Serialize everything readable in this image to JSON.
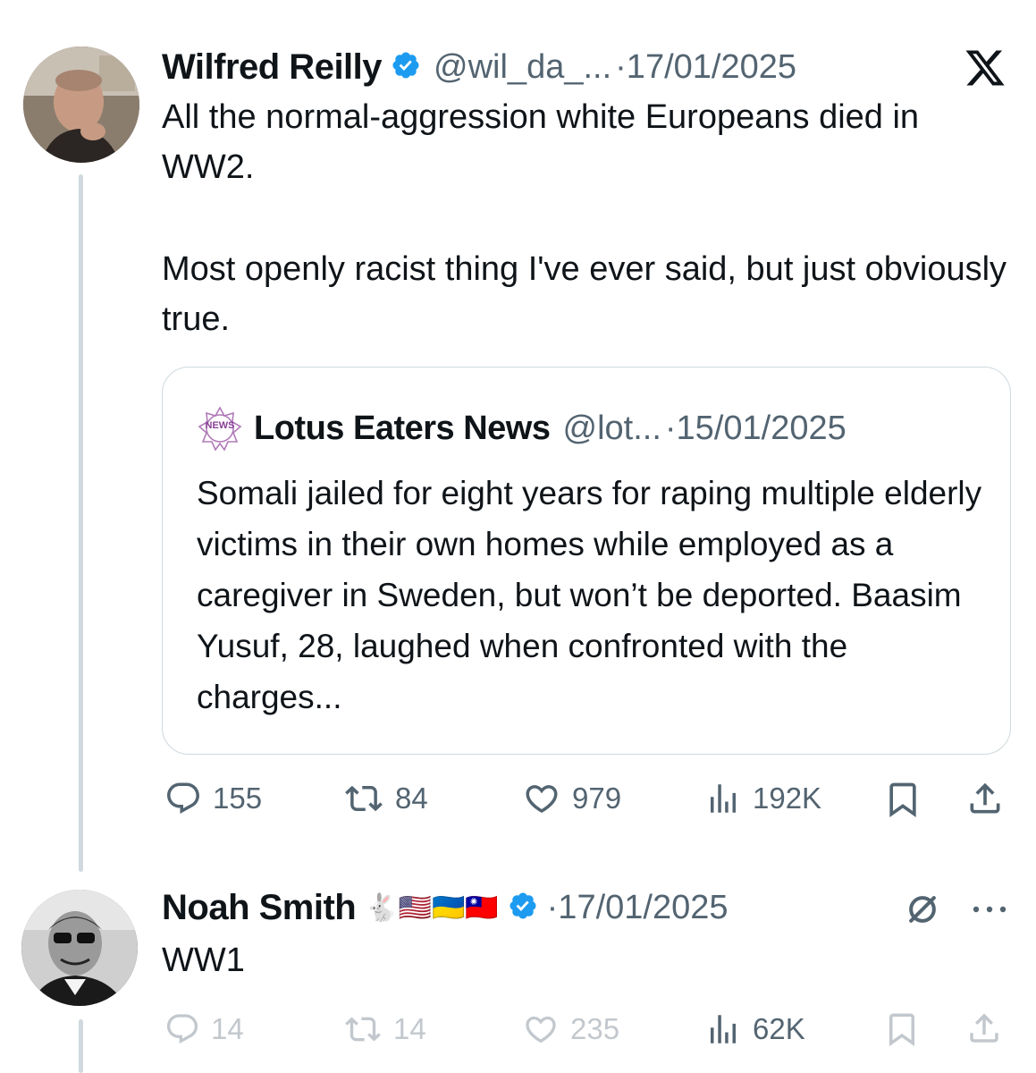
{
  "tweet": {
    "author_name": "Wilfred Reilly",
    "handle": "@wil_da_...",
    "date": "·17/01/2025",
    "body_line1": "All the normal-aggression white Europeans died in WW2.",
    "body_line2": "Most openly racist thing I've ever said, but just obviously true.",
    "quote": {
      "logo_text": "NEWS",
      "author_name": "Lotus Eaters News",
      "handle": "@lot...",
      "date": "·15/01/2025",
      "text": "Somali jailed for eight years for raping multiple elderly victims in their own homes while employed as a caregiver in Sweden, but won’t be deported. Baasim Yusuf, 28, laughed when confronted with the charges..."
    },
    "actions": {
      "replies": "155",
      "retweets": "84",
      "likes": "979",
      "views": "192K"
    }
  },
  "reply": {
    "author_name": "Noah Smith",
    "emoji_badges": "🐇🇺🇸🇺🇦🇹🇼",
    "date": "·17/01/2025",
    "body": "WW1",
    "actions": {
      "replies": "14",
      "retweets": "14",
      "likes": "235",
      "views": "62K"
    }
  },
  "icons": [
    "x-logo-icon",
    "verified-badge-icon",
    "reply-icon",
    "retweet-icon",
    "like-icon",
    "views-icon",
    "bookmark-icon",
    "share-icon",
    "mute-icon",
    "more-icon"
  ],
  "colors": {
    "verified": "#1d9bf0",
    "text": "#0f1419",
    "secondary": "#536471",
    "border": "#cfd9de"
  }
}
